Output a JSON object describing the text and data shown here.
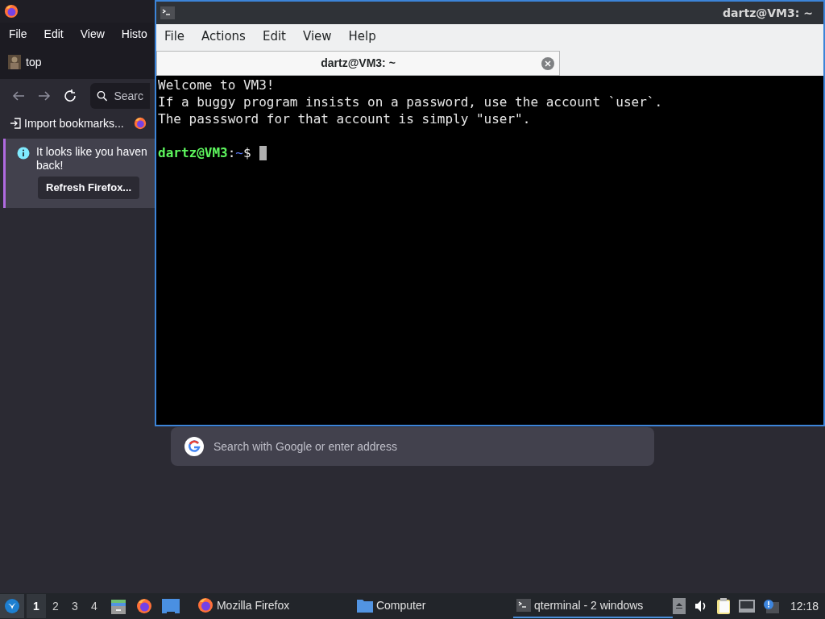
{
  "firefox": {
    "menu": [
      "File",
      "Edit",
      "View",
      "Histo"
    ],
    "tab": {
      "title": "top"
    },
    "search_placeholder": "Searc",
    "bookmarks": [
      {
        "label": "Import bookmarks..."
      }
    ],
    "notification": {
      "lines": [
        "It looks like you haven",
        "back!"
      ],
      "button": "Refresh Firefox..."
    },
    "address_placeholder": "Search with Google or enter address"
  },
  "terminal": {
    "title": "dartz@VM3: ~",
    "menu": [
      "File",
      "Actions",
      "Edit",
      "View",
      "Help"
    ],
    "tab": {
      "title": "dartz@VM3: ~",
      "selected": true
    },
    "lines": [
      "Welcome to VM3!",
      "If a buggy program insists on a password, use the account `user`.",
      "The passsword for that account is simply \"user\"."
    ],
    "prompt": {
      "user_host": "dartz@VM3",
      "separator": ":",
      "path": "~",
      "symbol": "$"
    }
  },
  "taskbar": {
    "workspaces": [
      {
        "label": "1",
        "selected": true
      },
      {
        "label": "2",
        "selected": false
      },
      {
        "label": "3",
        "selected": false
      },
      {
        "label": "4",
        "selected": false
      }
    ],
    "tasks": [
      {
        "kind": "firefox",
        "label": "Mozilla Firefox",
        "active": false
      },
      {
        "kind": "folder",
        "label": "Computer",
        "active": false
      },
      {
        "kind": "terminal",
        "label": "qterminal - 2 windows",
        "active": true
      }
    ],
    "clock": "12:18"
  }
}
